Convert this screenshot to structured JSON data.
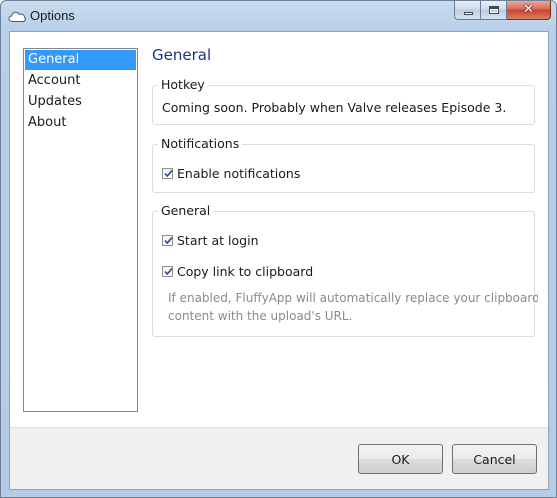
{
  "window": {
    "title": "Options",
    "icon": "cloud-icon",
    "caption_buttons": {
      "close_label": "✕"
    }
  },
  "nav": {
    "items": [
      {
        "label": "General",
        "selected": true
      },
      {
        "label": "Account",
        "selected": false
      },
      {
        "label": "Updates",
        "selected": false
      },
      {
        "label": "About",
        "selected": false
      }
    ]
  },
  "main": {
    "title": "General",
    "hotkey": {
      "legend": "Hotkey",
      "text": "Coming soon. Probably when Valve releases Episode 3."
    },
    "notifications": {
      "legend": "Notifications",
      "enable_label": "Enable notifications",
      "enable_checked": true
    },
    "general": {
      "legend": "General",
      "start_at_login_label": "Start at login",
      "start_at_login_checked": true,
      "copy_link_label": "Copy link to clipboard",
      "copy_link_checked": true,
      "help_line1": "If enabled, FluffyApp will automatically replace your clipboard's",
      "help_line2": "content with the upload's URL."
    }
  },
  "footer": {
    "ok_label": "OK",
    "cancel_label": "Cancel"
  },
  "colors": {
    "selection": "#3399ff",
    "section_title": "#1e3287"
  }
}
